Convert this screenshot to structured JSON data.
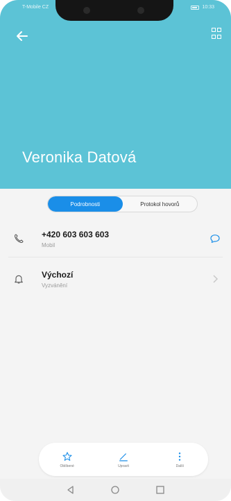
{
  "status_bar": {
    "carrier": "T-Mobile CZ",
    "time": "10:33"
  },
  "header": {
    "contact_name": "Veronika Datová",
    "color": "#5cc3d6"
  },
  "tabs": [
    {
      "label": "Podrobnosti",
      "active": true
    },
    {
      "label": "Protokol hovorů",
      "active": false
    }
  ],
  "rows": [
    {
      "icon": "phone-icon",
      "primary": "+420 603 603 603",
      "secondary": "Mobil",
      "action_icon": "message-icon"
    },
    {
      "icon": "bell-icon",
      "primary": "Výchozí",
      "secondary": "Vyzvánění",
      "action_icon": "chevron-right-icon"
    }
  ],
  "actions": [
    {
      "icon": "star-icon",
      "label": "Oblíbené"
    },
    {
      "icon": "edit-icon",
      "label": "Upravit"
    },
    {
      "icon": "more-icon",
      "label": "Další"
    }
  ],
  "accent_color": "#1a8ee8"
}
